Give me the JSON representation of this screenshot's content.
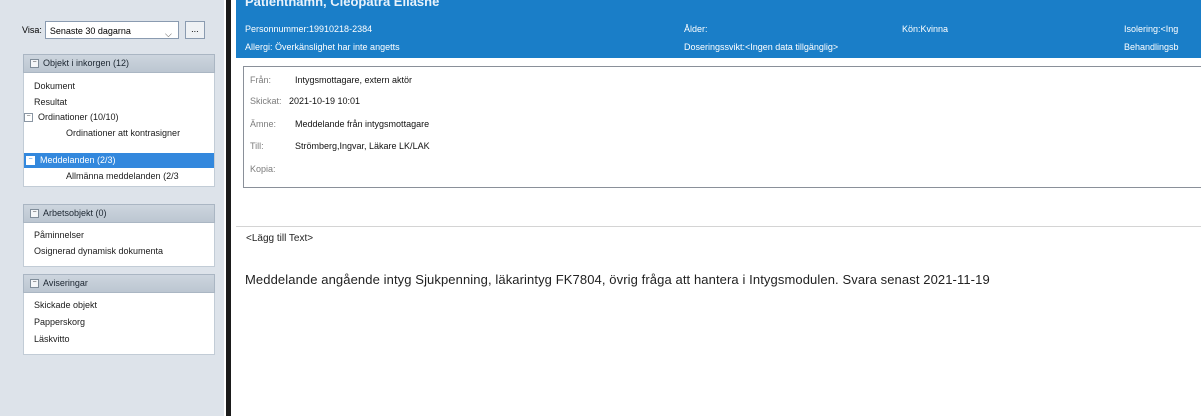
{
  "sidebar": {
    "visa_label": "Visa:",
    "visa_value": "Senaste 30 dagarna",
    "visa_button": "...",
    "sections": [
      {
        "header": "Objekt i inkorgen (12)",
        "items": [
          {
            "label": "Dokument"
          },
          {
            "label": "Resultat"
          },
          {
            "label": "Ordinationer (10/10)"
          },
          {
            "label": "Ordinationer att kontrasigner"
          },
          {
            "label": "Meddelanden (2/3)"
          },
          {
            "label": "Allmänna meddelanden (2/3"
          }
        ]
      },
      {
        "header": "Arbetsobjekt (0)",
        "items": [
          {
            "label": "Påminnelser"
          },
          {
            "label": "Osignerad dynamisk dokumenta"
          }
        ]
      },
      {
        "header": "Aviseringar",
        "items": [
          {
            "label": "Skickade objekt"
          },
          {
            "label": "Papperskorg"
          },
          {
            "label": "Läskvitto"
          }
        ]
      }
    ]
  },
  "patient": {
    "name": "Patientnamn, Cleopatra Eliasne",
    "personnummer": "Personnummer:19910218-2384",
    "alder": "Ålder:",
    "kon": "Kön:Kvinna",
    "isolering": "Isolering:<Ing",
    "allergi": "Allergi: Överkänslighet har inte angetts",
    "doseringssvikt": "Doseringssvikt:<Ingen data tillgänglig>",
    "behandling": "Behandlingsb"
  },
  "message": {
    "fran_label": "Från:",
    "fran_value": "Intygsmottagare, extern aktör",
    "skickat_label": "Skickat:",
    "skickat_value": "2021-10-19 10:01",
    "amne_label": "Ämne:",
    "amne_value": "Meddelande från intygsmottagare",
    "till_label": "Till:",
    "till_value": "Strömberg,Ingvar, Läkare LK/LAK",
    "kopia_label": "Kopia:",
    "kopia_value": ""
  },
  "body": {
    "add_text": "<Lägg till Text>",
    "text": "Meddelande angående intyg Sjukpenning, läkarintyg FK7804, övrig fråga att hantera i Intygsmodulen. Svara senast 2021-11-19"
  },
  "colors": {
    "header_bg": "#1a7ec8",
    "selected_bg": "#3388dd",
    "left_bg": "#dde3ea"
  },
  "icons": {
    "dropdown": "chevron-down-icon",
    "collapse": "minus-box-icon",
    "expand": "plus-box-icon"
  }
}
